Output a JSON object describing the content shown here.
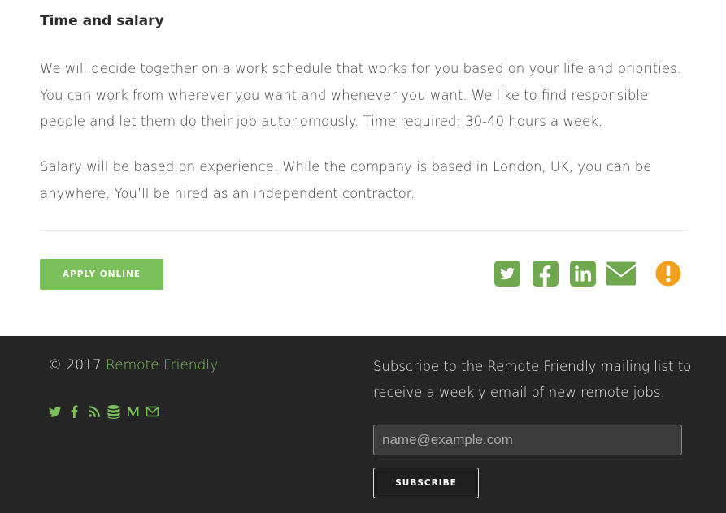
{
  "job": {
    "section_title": "Time and salary",
    "paragraph1": "We will decide together on a work schedule that works for you based on your life and priorities. You can work from wherever you want and whenever you want. We like to find responsible people and let them do their job autonomously. Time required: 30-40 hours a week.",
    "paragraph2": "Salary will be based on experience. While the company is based in London, UK, you can be anywhere. You’ll be hired as an independent contractor.",
    "apply_label": "APPLY ONLINE"
  },
  "share_icons": [
    "twitter-icon",
    "facebook-icon",
    "linkedin-icon",
    "email-icon",
    "report-icon"
  ],
  "footer": {
    "copyright_prefix": "© 2017 ",
    "brand_link": "Remote Friendly",
    "social_icons": [
      "twitter-icon",
      "facebook-icon",
      "rss-icon",
      "database-icon",
      "medium-icon",
      "envelope-icon"
    ],
    "subscribe_text": "Subscribe to the Remote Friendly mailing list to receive a weekly email of new remote jobs.",
    "email_placeholder": "name@example.com",
    "subscribe_label": "SUBSCRIBE"
  },
  "colors": {
    "accent_green": "#79c05a",
    "icon_green": "#6fa84e",
    "alert_orange": "#f0a01b",
    "footer_bg": "#252525"
  }
}
